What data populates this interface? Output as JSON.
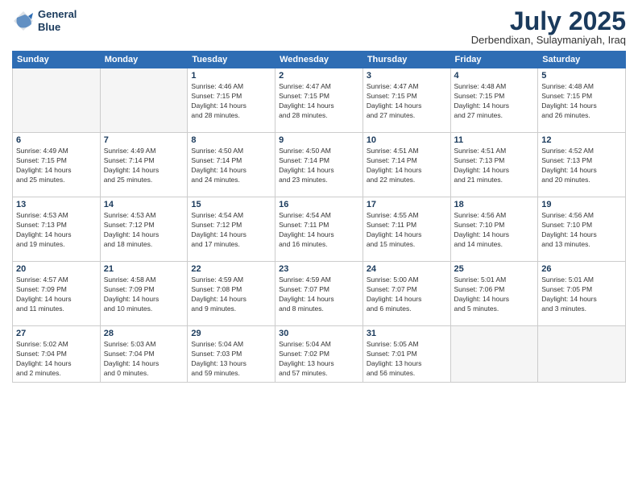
{
  "header": {
    "logo_line1": "General",
    "logo_line2": "Blue",
    "month": "July 2025",
    "location": "Derbendixan, Sulaymaniyah, Iraq"
  },
  "weekdays": [
    "Sunday",
    "Monday",
    "Tuesday",
    "Wednesday",
    "Thursday",
    "Friday",
    "Saturday"
  ],
  "weeks": [
    [
      {
        "day": "",
        "info": ""
      },
      {
        "day": "",
        "info": ""
      },
      {
        "day": "1",
        "info": "Sunrise: 4:46 AM\nSunset: 7:15 PM\nDaylight: 14 hours\nand 28 minutes."
      },
      {
        "day": "2",
        "info": "Sunrise: 4:47 AM\nSunset: 7:15 PM\nDaylight: 14 hours\nand 28 minutes."
      },
      {
        "day": "3",
        "info": "Sunrise: 4:47 AM\nSunset: 7:15 PM\nDaylight: 14 hours\nand 27 minutes."
      },
      {
        "day": "4",
        "info": "Sunrise: 4:48 AM\nSunset: 7:15 PM\nDaylight: 14 hours\nand 27 minutes."
      },
      {
        "day": "5",
        "info": "Sunrise: 4:48 AM\nSunset: 7:15 PM\nDaylight: 14 hours\nand 26 minutes."
      }
    ],
    [
      {
        "day": "6",
        "info": "Sunrise: 4:49 AM\nSunset: 7:15 PM\nDaylight: 14 hours\nand 25 minutes."
      },
      {
        "day": "7",
        "info": "Sunrise: 4:49 AM\nSunset: 7:14 PM\nDaylight: 14 hours\nand 25 minutes."
      },
      {
        "day": "8",
        "info": "Sunrise: 4:50 AM\nSunset: 7:14 PM\nDaylight: 14 hours\nand 24 minutes."
      },
      {
        "day": "9",
        "info": "Sunrise: 4:50 AM\nSunset: 7:14 PM\nDaylight: 14 hours\nand 23 minutes."
      },
      {
        "day": "10",
        "info": "Sunrise: 4:51 AM\nSunset: 7:14 PM\nDaylight: 14 hours\nand 22 minutes."
      },
      {
        "day": "11",
        "info": "Sunrise: 4:51 AM\nSunset: 7:13 PM\nDaylight: 14 hours\nand 21 minutes."
      },
      {
        "day": "12",
        "info": "Sunrise: 4:52 AM\nSunset: 7:13 PM\nDaylight: 14 hours\nand 20 minutes."
      }
    ],
    [
      {
        "day": "13",
        "info": "Sunrise: 4:53 AM\nSunset: 7:13 PM\nDaylight: 14 hours\nand 19 minutes."
      },
      {
        "day": "14",
        "info": "Sunrise: 4:53 AM\nSunset: 7:12 PM\nDaylight: 14 hours\nand 18 minutes."
      },
      {
        "day": "15",
        "info": "Sunrise: 4:54 AM\nSunset: 7:12 PM\nDaylight: 14 hours\nand 17 minutes."
      },
      {
        "day": "16",
        "info": "Sunrise: 4:54 AM\nSunset: 7:11 PM\nDaylight: 14 hours\nand 16 minutes."
      },
      {
        "day": "17",
        "info": "Sunrise: 4:55 AM\nSunset: 7:11 PM\nDaylight: 14 hours\nand 15 minutes."
      },
      {
        "day": "18",
        "info": "Sunrise: 4:56 AM\nSunset: 7:10 PM\nDaylight: 14 hours\nand 14 minutes."
      },
      {
        "day": "19",
        "info": "Sunrise: 4:56 AM\nSunset: 7:10 PM\nDaylight: 14 hours\nand 13 minutes."
      }
    ],
    [
      {
        "day": "20",
        "info": "Sunrise: 4:57 AM\nSunset: 7:09 PM\nDaylight: 14 hours\nand 11 minutes."
      },
      {
        "day": "21",
        "info": "Sunrise: 4:58 AM\nSunset: 7:09 PM\nDaylight: 14 hours\nand 10 minutes."
      },
      {
        "day": "22",
        "info": "Sunrise: 4:59 AM\nSunset: 7:08 PM\nDaylight: 14 hours\nand 9 minutes."
      },
      {
        "day": "23",
        "info": "Sunrise: 4:59 AM\nSunset: 7:07 PM\nDaylight: 14 hours\nand 8 minutes."
      },
      {
        "day": "24",
        "info": "Sunrise: 5:00 AM\nSunset: 7:07 PM\nDaylight: 14 hours\nand 6 minutes."
      },
      {
        "day": "25",
        "info": "Sunrise: 5:01 AM\nSunset: 7:06 PM\nDaylight: 14 hours\nand 5 minutes."
      },
      {
        "day": "26",
        "info": "Sunrise: 5:01 AM\nSunset: 7:05 PM\nDaylight: 14 hours\nand 3 minutes."
      }
    ],
    [
      {
        "day": "27",
        "info": "Sunrise: 5:02 AM\nSunset: 7:04 PM\nDaylight: 14 hours\nand 2 minutes."
      },
      {
        "day": "28",
        "info": "Sunrise: 5:03 AM\nSunset: 7:04 PM\nDaylight: 14 hours\nand 0 minutes."
      },
      {
        "day": "29",
        "info": "Sunrise: 5:04 AM\nSunset: 7:03 PM\nDaylight: 13 hours\nand 59 minutes."
      },
      {
        "day": "30",
        "info": "Sunrise: 5:04 AM\nSunset: 7:02 PM\nDaylight: 13 hours\nand 57 minutes."
      },
      {
        "day": "31",
        "info": "Sunrise: 5:05 AM\nSunset: 7:01 PM\nDaylight: 13 hours\nand 56 minutes."
      },
      {
        "day": "",
        "info": ""
      },
      {
        "day": "",
        "info": ""
      }
    ]
  ]
}
